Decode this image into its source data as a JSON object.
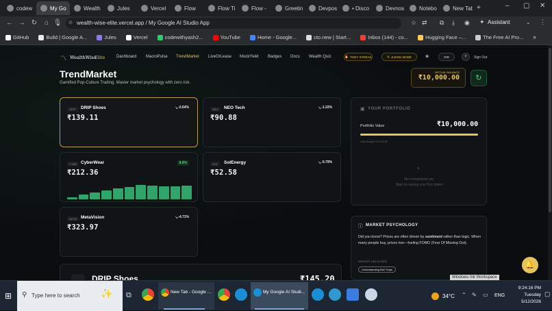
{
  "browser": {
    "tabs": [
      {
        "label": "codew",
        "icon": "github-icon"
      },
      {
        "label": "My Go",
        "icon": "google-ai-studio-icon",
        "active": true
      },
      {
        "label": "Wealth",
        "icon": "wealthwise-icon"
      },
      {
        "label": "Jules",
        "icon": "jules-icon"
      },
      {
        "label": "Vercel",
        "icon": "vercel-icon"
      },
      {
        "label": "Flow",
        "icon": "flow-icon"
      },
      {
        "label": "Flow Ti",
        "icon": "flow-icon"
      },
      {
        "label": "Flow -",
        "icon": "flow-icon"
      },
      {
        "label": "Greetin",
        "icon": "greetings-icon"
      },
      {
        "label": "Devpos",
        "icon": "devpost-icon"
      },
      {
        "label": "• Disco",
        "icon": "discord-icon"
      },
      {
        "label": "Devnos",
        "icon": "devnos-icon"
      },
      {
        "label": "Notebo",
        "icon": "notebook-icon"
      },
      {
        "label": "New Tab",
        "icon": "newtab-icon"
      }
    ],
    "new_tab_glyph": "+",
    "url": "wealth-wise-elite.vercel.app / My Google AI Studio App",
    "assistant_label": "Assistant",
    "bookmarks": [
      {
        "label": "GitHub",
        "color": "#ffffff"
      },
      {
        "label": "Build | Google A...",
        "color": "#e8eaed"
      },
      {
        "label": "Jules",
        "color": "#8a7cf0"
      },
      {
        "label": "Vercel",
        "color": "#ffffff"
      },
      {
        "label": "codewithyash2...",
        "color": "#2ecc71"
      },
      {
        "label": "YouTube",
        "color": "#ff0000"
      },
      {
        "label": "Home - Google...",
        "color": "#4285f4"
      },
      {
        "label": "cto.new | Start...",
        "color": "#dddddd"
      },
      {
        "label": "Inbox (144) - co...",
        "color": "#ea4335"
      },
      {
        "label": "Hugging Face –...",
        "color": "#ffcc4d"
      },
      {
        "label": "The Free AI Pro...",
        "color": "#cccccc"
      }
    ],
    "bookmarks_more": "»"
  },
  "app": {
    "brand": "WealthWise",
    "brand_suffix": "Elite",
    "nav": [
      "Dashboard",
      "MacroPulse",
      "TrendMarket",
      "LiveOrLease",
      "MockYield",
      "Badges",
      "Docs",
      "Wealth Quiz"
    ],
    "active_nav": "TrendMarket",
    "streak_label": "TONY STREAK",
    "judge_label": "JUDGE MODE",
    "currency_label": "INR",
    "avatar_letter": "Y",
    "signout_label": "Sign Out",
    "title": "TrendMarket",
    "subtitle": "Gamified Pop-Culture Trading. Master market psychology with zero risk.",
    "balance_label": "VIRTUAL BALANCE",
    "balance_value": "₹10,000.00",
    "accent": "#e7c35a",
    "tickers": [
      {
        "tag": "DRIP",
        "name": "DRIP Shoes",
        "change": "-0.64%",
        "price": "₹139.11",
        "selected": true
      },
      {
        "tag": "NEO",
        "name": "NEO Tech",
        "change": "-1.22%",
        "price": "₹90.88"
      },
      {
        "tag": "CYBR",
        "name": "CyberWear",
        "change": "8.9%",
        "price": "₹212.36",
        "up": true,
        "bars": [
          0.15,
          0.3,
          0.45,
          0.6,
          0.72,
          0.82,
          0.95,
          0.92,
          0.88,
          0.85,
          0.9
        ]
      },
      {
        "tag": "SOL",
        "name": "SolEnergy",
        "change": "-0.79%",
        "price": "₹52.58"
      },
      {
        "tag": "META",
        "name": "MetaVision",
        "change": "-4.71%",
        "price": "₹323.97"
      }
    ],
    "detail": {
      "name": "DRIP Shoes",
      "price": "₹145.20"
    },
    "portfolio": {
      "title": "YOUR PORTFOLIO",
      "value_label": "Portfolio Value",
      "value": "₹10,000.00",
      "small_label": "Cash Budget: ₹10,000.00",
      "empty_line1": "No investments yet.",
      "empty_line2": "Start by buying your first share!"
    },
    "psychology": {
      "title": "MARKET PSYCHOLOGY",
      "body_pre": "Did you know? Prices are often driven by ",
      "body_em": "sentiment",
      "body_post": " rather than logic. When many people buy, prices rise—fueling FOMO (Fear Of Missing Out).",
      "insight_label": "INSIGHT UNLOCKED",
      "insight_button": "Understanding Bull Traps"
    }
  },
  "watermark": "Windows Ink Workspace",
  "taskbar": {
    "search_placeholder": "Type here to search",
    "windows": [
      {
        "label": "New Tab - Google ..."
      },
      {
        "label": "My Google AI Studi..."
      }
    ],
    "temperature": "34°C",
    "lang": "ENG",
    "time": "9:24:16 PM",
    "day": "Tuesday",
    "date": "5/12/2026"
  }
}
